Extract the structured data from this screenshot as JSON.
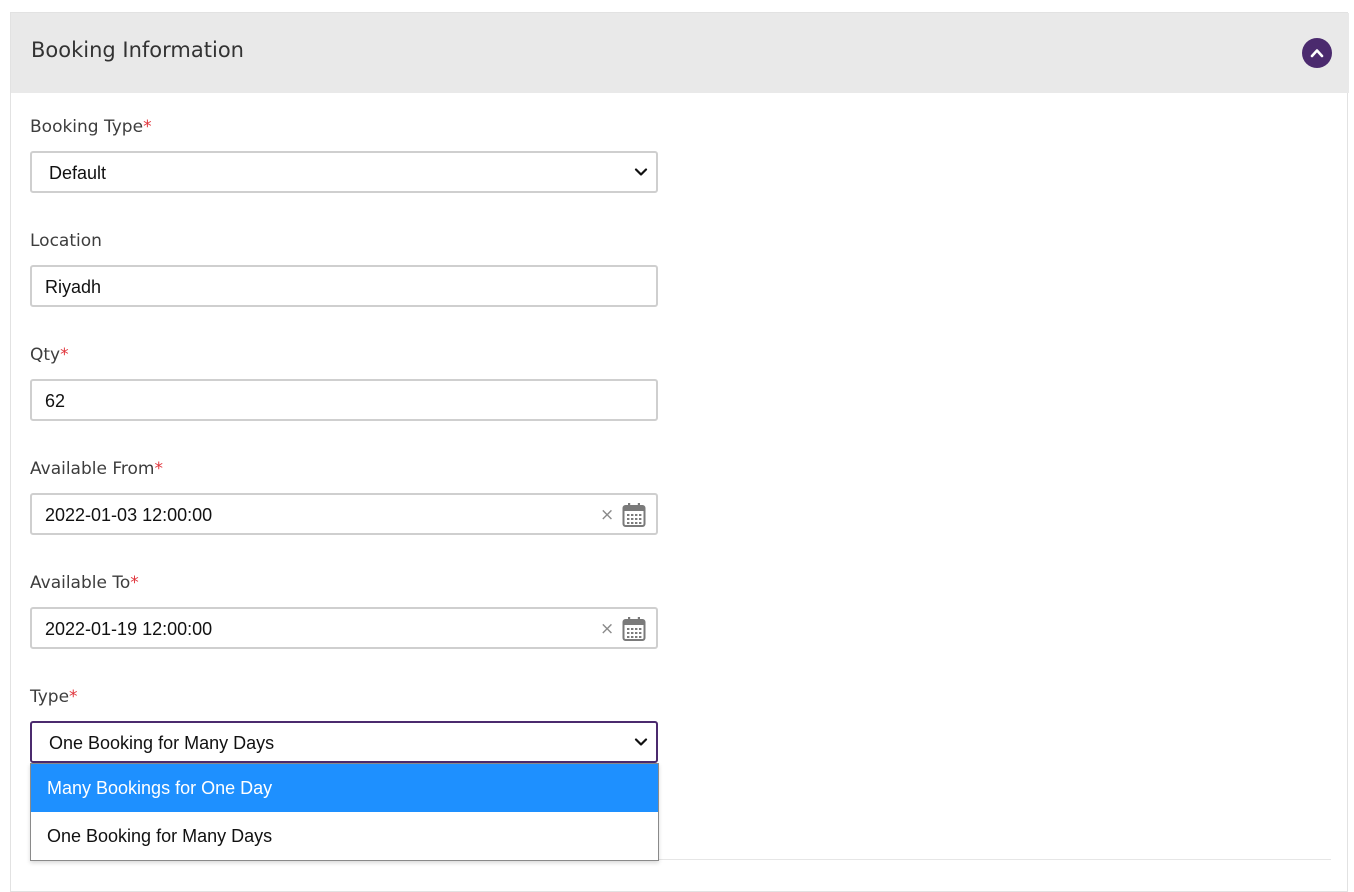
{
  "panel": {
    "title": "Booking Information",
    "collapse_icon": "chevron-up-icon",
    "accent_color": "#4b2a6e"
  },
  "fields": {
    "booking_type": {
      "label": "Booking Type",
      "required_mark": "*",
      "value": "Default"
    },
    "location": {
      "label": "Location",
      "value": "Riyadh"
    },
    "qty": {
      "label": "Qty",
      "required_mark": "*",
      "value": "62"
    },
    "available_from": {
      "label": "Available From",
      "required_mark": "*",
      "value": "2022-01-03 12:00:00",
      "clear_glyph": "×"
    },
    "available_to": {
      "label": "Available To",
      "required_mark": "*",
      "value": "2022-01-19 12:00:00",
      "clear_glyph": "×"
    },
    "type": {
      "label": "Type",
      "required_mark": "*",
      "value": "One Booking for Many Days",
      "options": [
        "Many Bookings for One Day",
        "One Booking for Many Days"
      ],
      "highlighted_option": "Many Bookings for One Day",
      "highlight_color": "#1e90ff"
    }
  }
}
